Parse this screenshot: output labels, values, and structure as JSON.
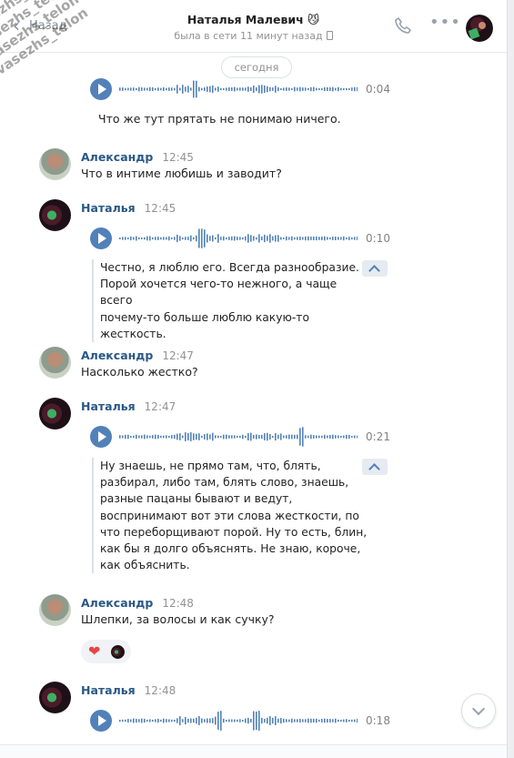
{
  "header": {
    "back_label": "Назад",
    "peer_name": "Наталья Малевич 😼",
    "peer_status": "была в сети 11 минут назад",
    "icons": [
      "chevron-left-icon",
      "phone-icon",
      "more-icon",
      "avatar"
    ]
  },
  "divider": {
    "date_label": "сегодня"
  },
  "messages": [
    {
      "author": "",
      "time": "",
      "audio": {
        "duration": "0:04"
      },
      "transcript": "Что же тут прятать не понимаю ничего."
    },
    {
      "author": "Александр",
      "time": "12:45",
      "text": "Что в интиме любишь и заводит?"
    },
    {
      "author": "Наталья",
      "time": "12:45",
      "audio": {
        "duration": "0:10"
      },
      "transcript": "Честно, я люблю его. Всегда разнообразие.\nПорой хочется чего-то нежного, а чаще всего\nпочему-то больше люблю какую-то\nжесткость."
    },
    {
      "author": "Александр",
      "time": "12:47",
      "text": "Насколько жестко?"
    },
    {
      "author": "Наталья",
      "time": "12:47",
      "audio": {
        "duration": "0:21"
      },
      "transcript": "Ну знаешь, не прямо там, что, блять,\nразбирал, либо там, блять слово, знаешь,\nразные пацаны бывают и ведут,\nвоспринимают вот эти слова жесткости, по\nчто переборщивают порой. Ну то есть, блин,\nкак бы я долго объяснять. Не знаю, короче,\nкак объяснить."
    },
    {
      "author": "Александр",
      "time": "12:48",
      "text": "Шлепки, за волосы и как сучку?",
      "reaction": "❤"
    },
    {
      "author": "Наталья",
      "time": "12:48",
      "audio": {
        "duration": "0:18"
      }
    }
  ],
  "watermark": {
    "lines": [
      "t.me/khvasezhs_telon",
      "t.me/khvasezhs_telon",
      "t.me/khvasezhs_telon",
      "t.me/khvasezhs_telon"
    ]
  },
  "colors": {
    "accent": "#5181b8",
    "author_link": "#2a5885",
    "muted": "#939393",
    "background": "#edeef0"
  }
}
